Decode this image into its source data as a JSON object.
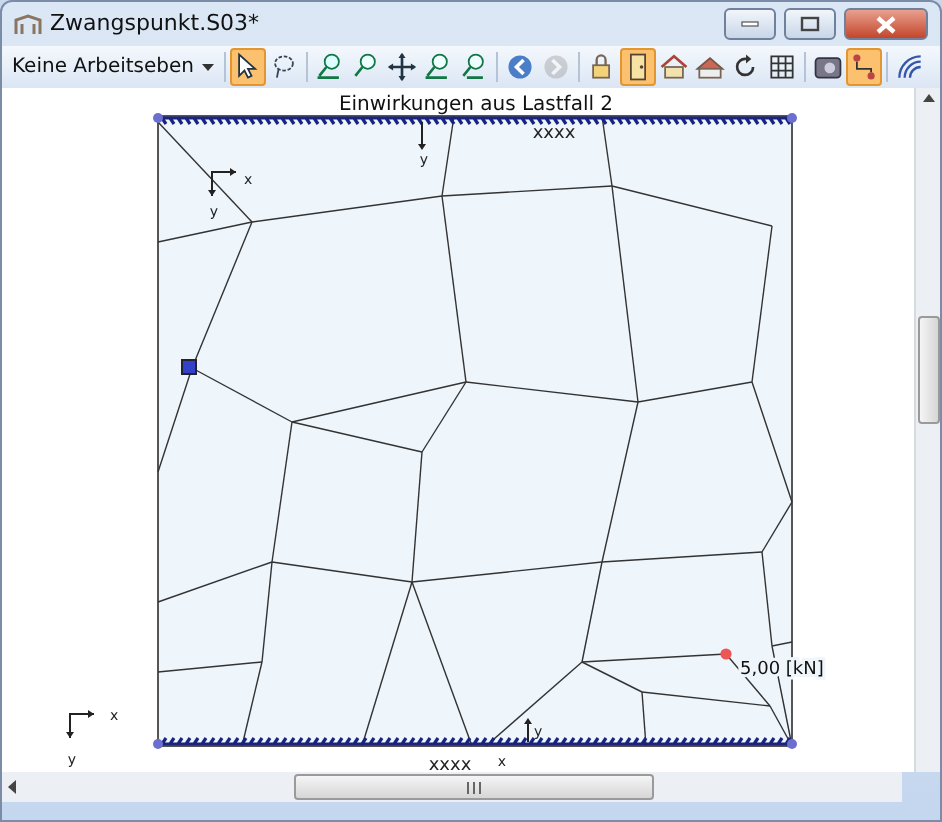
{
  "window": {
    "title": "Zwangspunkt.S03*"
  },
  "toolbar": {
    "dropdown": {
      "label": "Keine Arbeitseben"
    },
    "tools": [
      {
        "selected": true,
        "disabled": false
      },
      {
        "selected": false,
        "disabled": false
      },
      {
        "selected": false,
        "disabled": false
      },
      {
        "selected": false,
        "disabled": false
      },
      {
        "selected": false,
        "disabled": false
      },
      {
        "selected": false,
        "disabled": false
      },
      {
        "selected": false,
        "disabled": false
      },
      {
        "selected": false,
        "disabled": false
      },
      {
        "selected": false,
        "disabled": true
      },
      {
        "selected": false,
        "disabled": false
      },
      {
        "selected": true,
        "disabled": false
      },
      {
        "selected": false,
        "disabled": false
      },
      {
        "selected": false,
        "disabled": false
      },
      {
        "selected": false,
        "disabled": false
      },
      {
        "selected": false,
        "disabled": false
      },
      {
        "selected": false,
        "disabled": false
      },
      {
        "selected": true,
        "disabled": false
      },
      {
        "selected": false,
        "disabled": false
      }
    ]
  },
  "diagram": {
    "title": "Einwirkungen aus Lastfall 2",
    "labels": [
      {
        "text": "xxxx"
      },
      {
        "text": "y"
      },
      {
        "text": "x"
      },
      {
        "text": "y"
      },
      {
        "text": "xxxx"
      },
      {
        "text": "x"
      },
      {
        "text": "y"
      },
      {
        "text": "x"
      },
      {
        "text": "y"
      }
    ],
    "load": {
      "text": "5,00 [kN]"
    }
  }
}
